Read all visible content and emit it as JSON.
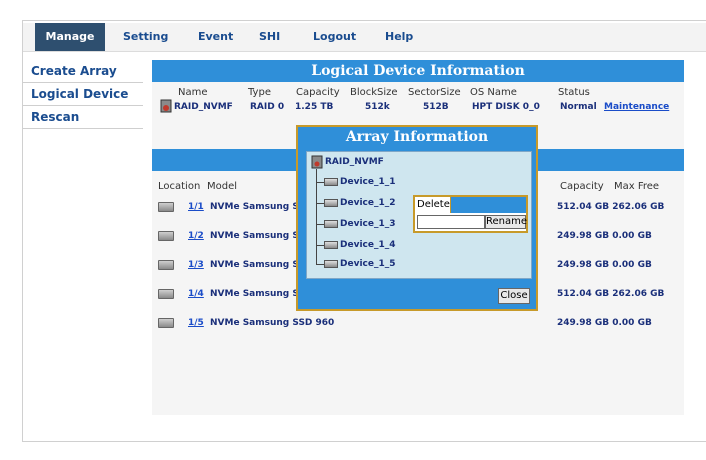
{
  "tabs": [
    "Manage",
    "Setting",
    "Event",
    "SHI",
    "Logout",
    "Help"
  ],
  "sidebar": {
    "items": [
      "Create Array",
      "Logical Device",
      "Rescan"
    ]
  },
  "logical_panel": {
    "title": "Logical Device Information",
    "headers": [
      "Name",
      "Type",
      "Capacity",
      "BlockSize",
      "SectorSize",
      "OS Name",
      "Status"
    ],
    "row": {
      "name": "RAID_NVMF",
      "type": "RAID 0",
      "capacity": "1.25 TB",
      "block": "512k",
      "sector": "512B",
      "os": "HPT DISK 0_0",
      "status": "Normal",
      "maintenance": "Maintenance"
    }
  },
  "physical_panel": {
    "headers": {
      "location": "Location",
      "model": "Model",
      "capacity": "Capacity",
      "max_free": "Max Free"
    },
    "rows": [
      {
        "loc": "1/1",
        "model": "NVMe Samsung S",
        "cap": "512.04 GB 262.06 GB"
      },
      {
        "loc": "1/2",
        "model": "NVMe Samsung S",
        "cap": "249.98 GB 0.00 GB"
      },
      {
        "loc": "1/3",
        "model": "NVMe Samsung S",
        "cap": "249.98 GB 0.00 GB"
      },
      {
        "loc": "1/4",
        "model": "NVMe Samsung S",
        "cap": "512.04 GB 262.06 GB"
      },
      {
        "loc": "1/5",
        "model": "NVMe Samsung SSD 960",
        "cap": "249.98 GB 0.00 GB"
      }
    ]
  },
  "modal": {
    "title": "Array Information",
    "array_name": "RAID_NVMF",
    "devices": [
      "Device_1_1",
      "Device_1_2",
      "Device_1_3",
      "Device_1_4",
      "Device_1_5"
    ],
    "close": "Close"
  },
  "context_menu": {
    "delete": "Delete",
    "rename": "Rename"
  }
}
